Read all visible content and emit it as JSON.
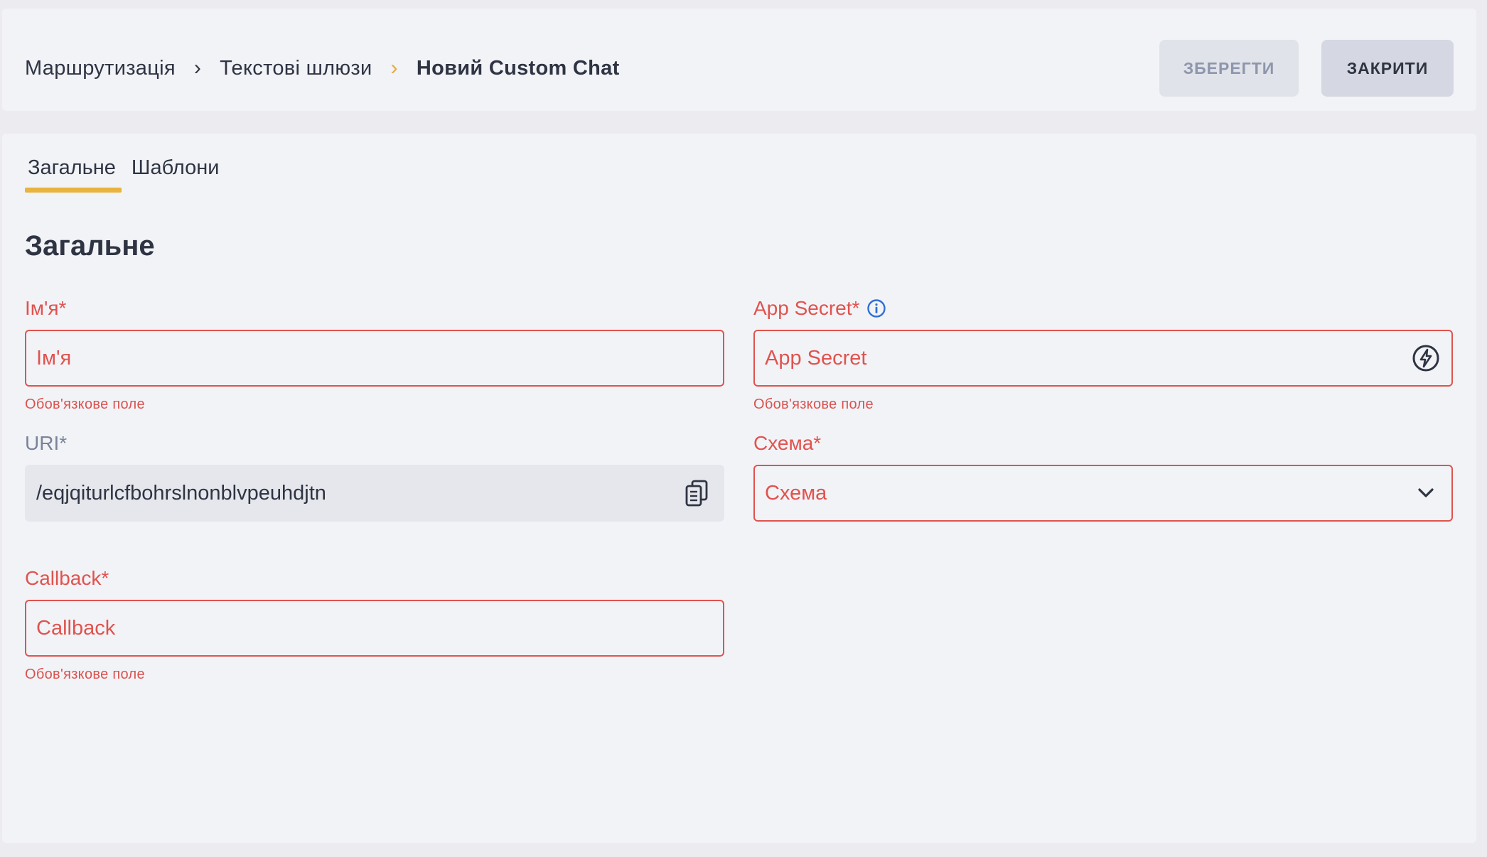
{
  "breadcrumb": {
    "items": [
      "Маршрутизація",
      "Текстові шлюзи",
      "Новий Custom Chat"
    ]
  },
  "toolbar": {
    "save_label": "ЗБЕРЕГТИ",
    "close_label": "ЗАКРИТИ"
  },
  "tabs": [
    {
      "label": "Загальне",
      "active": true
    },
    {
      "label": "Шаблони",
      "active": false
    }
  ],
  "section": {
    "title": "Загальне"
  },
  "form": {
    "name": {
      "label": "Ім'я*",
      "placeholder": "Ім'я",
      "error": "Обов'язкове поле"
    },
    "app_secret": {
      "label": "App Secret*",
      "placeholder": "App Secret",
      "error": "Обов'язкове поле"
    },
    "uri": {
      "label": "URI*",
      "value": "/eqjqiturlcfbohrslnonblvpeuhdjtn"
    },
    "schema": {
      "label": "Схема*",
      "placeholder": "Схема"
    },
    "callback": {
      "label": "Callback*",
      "placeholder": "Callback",
      "error": "Обов'язкове поле"
    }
  },
  "colors": {
    "accent": "#e8b33e",
    "error": "#e0534e",
    "info": "#2f6fd6",
    "text": "#2f3443"
  },
  "icons": {
    "breadcrumb_separator": "chevron-right-icon",
    "app_secret_info": "info-icon",
    "app_secret_generate": "lightning-icon",
    "uri_copy": "copy-icon",
    "schema_dropdown": "chevron-down-icon"
  }
}
